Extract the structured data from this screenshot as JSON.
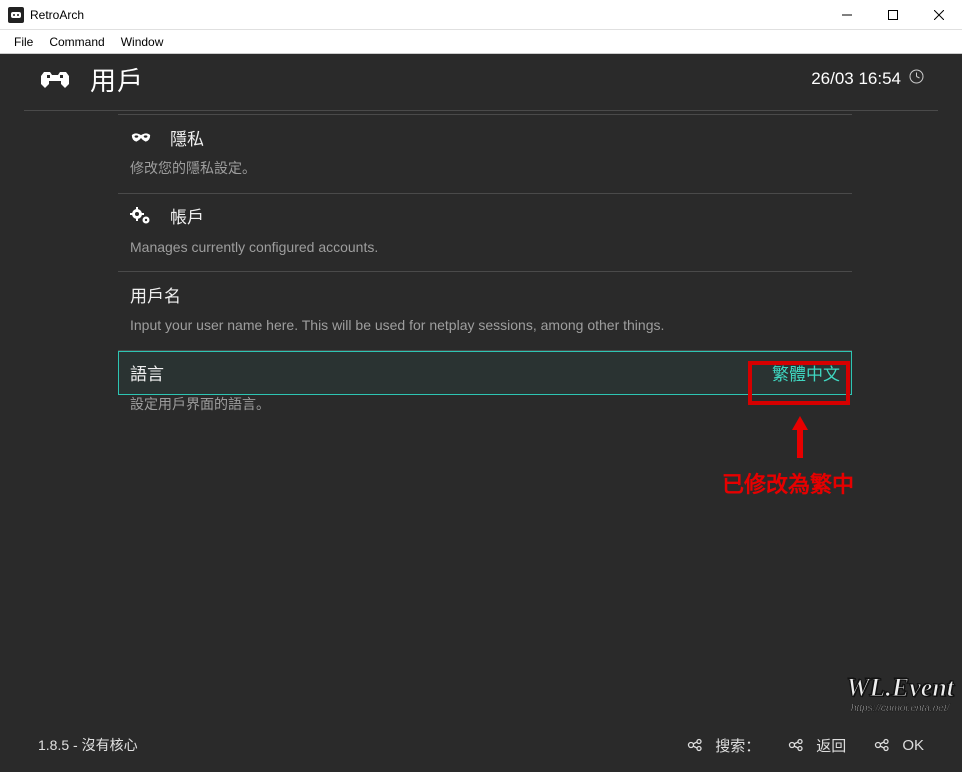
{
  "window": {
    "title": "RetroArch"
  },
  "menubar": {
    "items": [
      "File",
      "Command",
      "Window"
    ]
  },
  "header": {
    "title": "用戶",
    "datetime": "26/03 16:54"
  },
  "settings": [
    {
      "icon": "mask",
      "label": "隱私",
      "value": "",
      "desc": "修改您的隱私設定。",
      "selected": false
    },
    {
      "icon": "gears",
      "label": "帳戶",
      "value": "",
      "desc": "Manages currently configured accounts.",
      "selected": false
    },
    {
      "icon": "",
      "label": "用戶名",
      "value": "",
      "desc": "Input your user name here. This will be used for netplay sessions, among other things.",
      "selected": false
    },
    {
      "icon": "",
      "label": "語言",
      "value": "繁體中文",
      "desc": "設定用戶界面的語言。",
      "selected": true
    }
  ],
  "annotation": {
    "text": "已修改為繁中"
  },
  "footer": {
    "version": "1.8.5 - 沒有核心",
    "buttons": [
      {
        "label": "搜索："
      },
      {
        "label": "返回"
      },
      {
        "label": "OK"
      }
    ]
  },
  "watermark": {
    "main": "WL.Event",
    "sub": "https://cumoi.enta.net/"
  }
}
